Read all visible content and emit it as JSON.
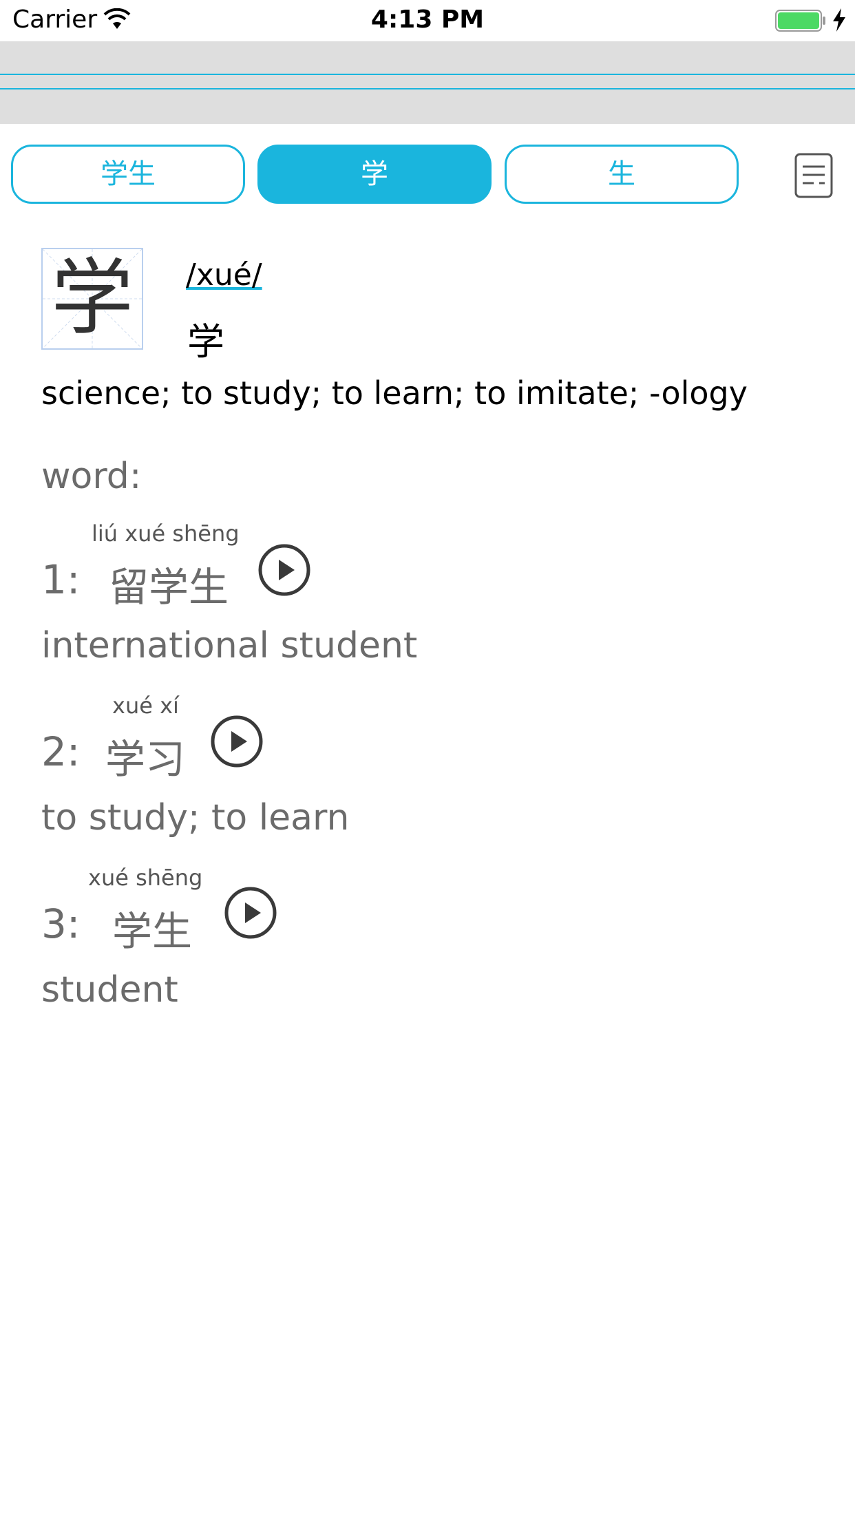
{
  "status_bar": {
    "carrier": "Carrier",
    "time": "4:13 PM"
  },
  "tabs": [
    {
      "label": "学生",
      "active": false
    },
    {
      "label": "学",
      "active": true
    },
    {
      "label": "生",
      "active": false
    }
  ],
  "character": {
    "glyph": "学",
    "pinyin": "/xué/",
    "hanzi": "学",
    "definition": "science; to study; to learn; to imitate; -ology"
  },
  "words_heading": "word:",
  "words": [
    {
      "number": "1:",
      "pinyin": "liú xué shēng",
      "hanzi": "留学生",
      "meaning": "international student"
    },
    {
      "number": "2:",
      "pinyin": "xué xí",
      "hanzi": "学习",
      "meaning": "to study; to learn"
    },
    {
      "number": "3:",
      "pinyin": "xué shēng",
      "hanzi": "学生",
      "meaning": "student"
    }
  ],
  "colors": {
    "accent": "#1ab5dd",
    "band": "#dedede",
    "text_grey": "#6b6b6b",
    "battery": "#4cd964"
  },
  "icons": [
    "wifi-icon",
    "battery-icon",
    "charging-bolt-icon",
    "notes-icon",
    "play-icon"
  ]
}
